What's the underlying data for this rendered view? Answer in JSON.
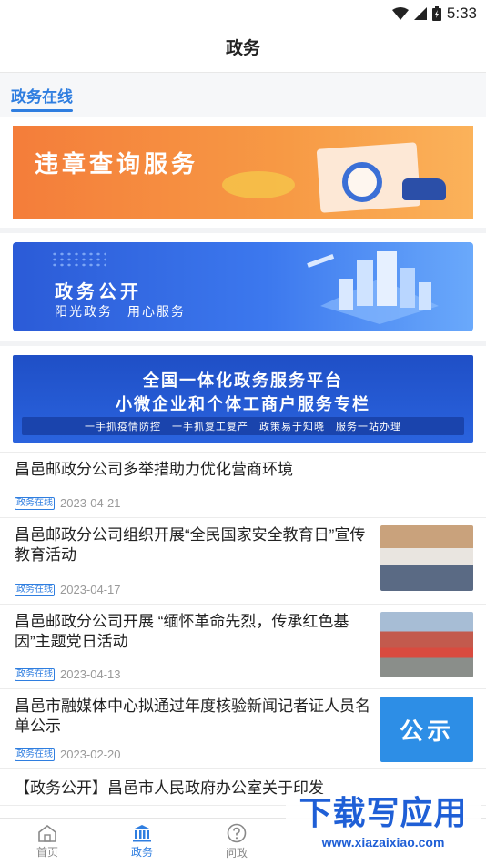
{
  "status_bar": {
    "time": "5:33"
  },
  "header": {
    "title": "政务"
  },
  "section": {
    "title": "政务在线"
  },
  "banners": [
    {
      "text": "违章查询服务"
    },
    {
      "title": "政务公开",
      "subtitle": "阳光政务　用心服务"
    },
    {
      "line1": "全国一体化政务服务平台",
      "line2": "小微企业和个体工商户服务专栏",
      "line3": "一手抓疫情防控　一手抓复工复产　政策易于知晓　服务一站办理"
    }
  ],
  "news": [
    {
      "title": "昌邑邮政分公司多举措助力优化营商环境",
      "tag": "政务在线",
      "date": "2023-04-21"
    },
    {
      "title": "昌邑邮政分公司组织开展“全民国家安全教育日”宣传教育活动",
      "tag": "政务在线",
      "date": "2023-04-17"
    },
    {
      "title": "昌邑邮政分公司开展 “缅怀革命先烈，传承红色基因”主题党日活动",
      "tag": "政务在线",
      "date": "2023-04-13"
    },
    {
      "title": "昌邑市融媒体中心拟通过年度核验新闻记者证人员名单公示",
      "tag": "政务在线",
      "date": "2023-02-20",
      "thumb_text": "公示"
    },
    {
      "title": "【政务公开】昌邑市人民政府办公室关于印发"
    }
  ],
  "tabs": [
    {
      "label": "首页",
      "icon": "home-icon"
    },
    {
      "label": "政务",
      "icon": "government-icon"
    },
    {
      "label": "问政",
      "icon": "question-icon"
    }
  ],
  "watermark": {
    "main": "下载写应用",
    "sub": "www.xiazaixiao.com"
  },
  "colors": {
    "accent": "#2f7ee0"
  }
}
